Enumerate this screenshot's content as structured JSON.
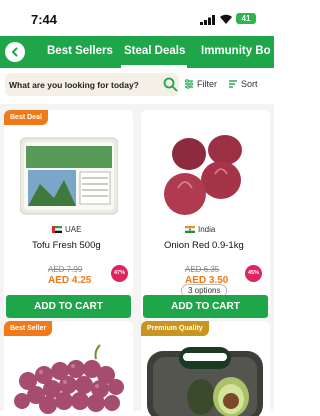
{
  "status": {
    "time": "7:44",
    "battery": "41"
  },
  "tabs": [
    {
      "label": "Best Sellers"
    },
    {
      "label": "Steal Deals"
    },
    {
      "label": "Immunity Bo"
    }
  ],
  "search": {
    "placeholder": "What are you looking for today?"
  },
  "controls": {
    "filter_label": "Filter",
    "sort_label": "Sort"
  },
  "products": [
    {
      "badge": "Best Deal",
      "origin": "UAE",
      "name": "Tofu Fresh 500g",
      "old_price": "AED 7.99",
      "price": "AED 4.25",
      "discount": "47%",
      "cart": "ADD TO CART"
    },
    {
      "badge": "",
      "origin": "India",
      "name": "Onion Red 0.9-1kg",
      "old_price": "AED 6.35",
      "price": "AED 3.50",
      "discount": "45%",
      "cart": "ADD TO CART",
      "options": "3 options"
    },
    {
      "badge": "Best Seller"
    },
    {
      "badge": "Premium Quality"
    }
  ],
  "colors": {
    "brand": "#1fa64a",
    "price": "#f07a1a",
    "discount": "#e0245e"
  }
}
